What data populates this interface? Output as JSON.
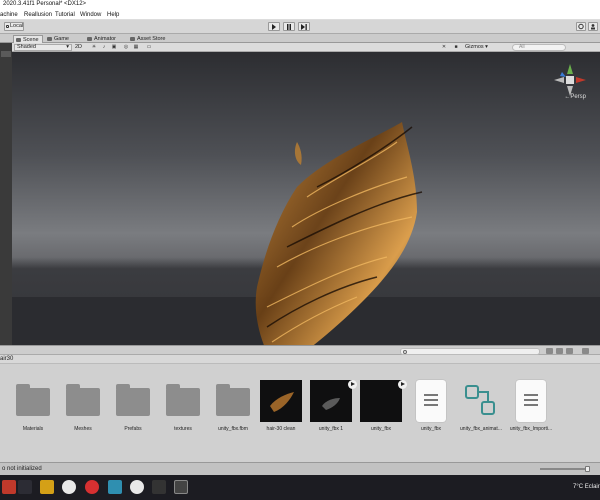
{
  "window": {
    "title": "2020.3.41f1 Personal* <DX12>"
  },
  "menu": [
    "achine",
    "Reallusion",
    "Tutorial",
    "Window",
    "Help"
  ],
  "toolbar": {
    "local_label": "Local"
  },
  "tabs": [
    {
      "label": "Scene",
      "icon": "scene-icon",
      "active": true
    },
    {
      "label": "Game",
      "icon": "game-icon",
      "active": false
    },
    {
      "label": "Animator",
      "icon": "animator-icon",
      "active": false
    },
    {
      "label": "Asset Store",
      "icon": "asset-store-icon",
      "active": false
    }
  ],
  "scene_toolbar": {
    "shading_mode": "Shaded",
    "mode_2d": "2D",
    "gizmos_label": "Gizmos",
    "search_placeholder": "All"
  },
  "viewport": {
    "projection_label": "←Persp"
  },
  "project": {
    "folder_path": "air30",
    "assets": [
      {
        "label": "Materials",
        "kind": "folder"
      },
      {
        "label": "Meshes",
        "kind": "folder"
      },
      {
        "label": "Prefabs",
        "kind": "folder"
      },
      {
        "label": "textures",
        "kind": "folder"
      },
      {
        "label": "unity_fbx.fbm",
        "kind": "folder"
      },
      {
        "label": "hair-30 clean",
        "kind": "model"
      },
      {
        "label": "unity_fbx 1",
        "kind": "model"
      },
      {
        "label": "unity_fbx",
        "kind": "model"
      },
      {
        "label": "unity_fbx",
        "kind": "document"
      },
      {
        "label": "unity_fbx_animat...",
        "kind": "animator"
      },
      {
        "label": "unity_fbx_Importi...",
        "kind": "document"
      }
    ]
  },
  "status": {
    "text": "o not initialized"
  },
  "taskbar": {
    "weather": "7°C  Eclair"
  },
  "colors": {
    "viewport_bg": "#4e5055",
    "floor": "#2b2c30",
    "hair": "#8a5a1e",
    "accent": "#3a7bd5"
  }
}
